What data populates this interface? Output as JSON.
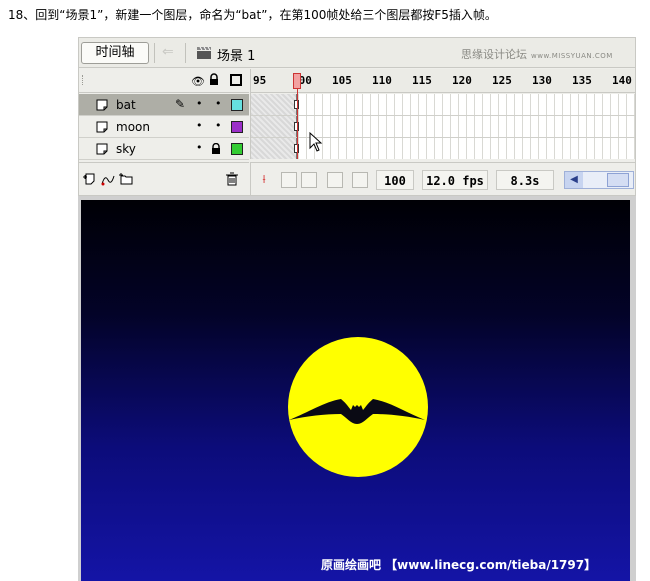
{
  "instruction": "18、回到“场景1”，新建一个图层，命名为“bat”，在第100帧处给三个图层都按F5插入帧。",
  "header": {
    "timeline_button": "时间轴",
    "scene_name": "场景 1",
    "watermark_cn": "思缘设计论坛",
    "watermark_url": "www.MISSYUAN.COM"
  },
  "ruler": {
    "ticks": [
      "95",
      "100",
      "105",
      "110",
      "115",
      "120",
      "125",
      "130",
      "135",
      "140"
    ],
    "current_frame_marker": "100"
  },
  "layers": [
    {
      "name": "bat",
      "selected": true,
      "color": "#66e0e0",
      "locked": false,
      "editing": true
    },
    {
      "name": "moon",
      "selected": false,
      "color": "#9b30c8",
      "locked": false,
      "editing": false
    },
    {
      "name": "sky",
      "selected": false,
      "color": "#33cc33",
      "locked": true,
      "editing": false
    }
  ],
  "status": {
    "current_frame": "100",
    "frame_rate": "12.0 fps",
    "elapsed_time": "8.3s"
  },
  "stage": {
    "credit_text": "原画绘画吧 【www.linecg.com/tieba/1797】",
    "moon_color": "#ffff00",
    "sky_top_color": "#000005",
    "sky_bottom_color": "#1414a6"
  }
}
